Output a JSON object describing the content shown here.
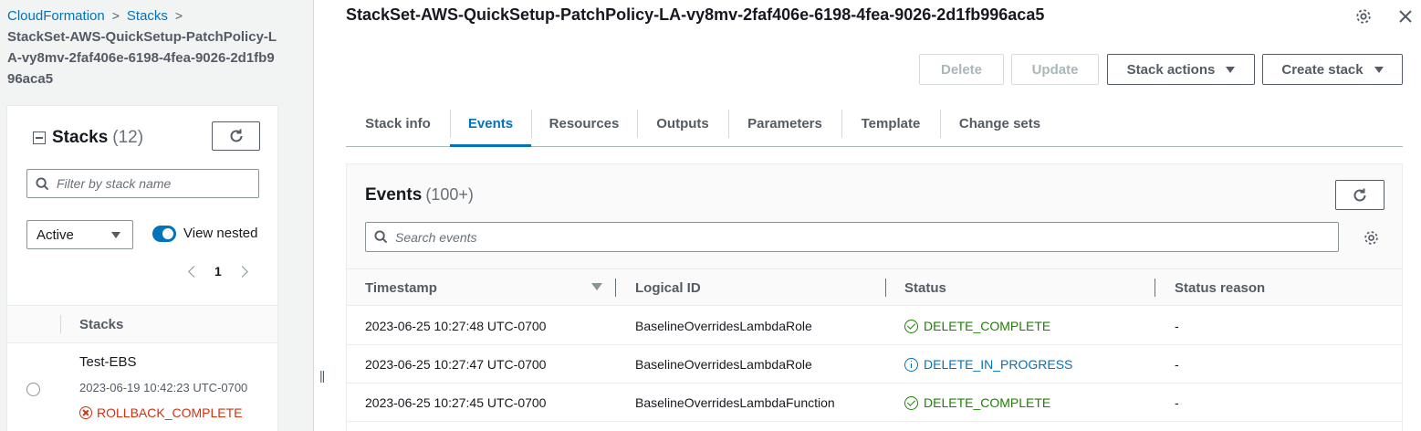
{
  "breadcrumb": {
    "items": [
      "CloudFormation",
      "Stacks"
    ],
    "current": "StackSet-AWS-QuickSetup-PatchPolicy-LA-vy8mv-2faf406e-6198-4fea-9026-2d1fb996aca5"
  },
  "stacks_panel": {
    "title": "Stacks",
    "count": "(12)",
    "filter_placeholder": "Filter by stack name",
    "status_filter": "Active",
    "view_nested_label": "View nested",
    "page": "1",
    "column_header": "Stacks",
    "stacks": [
      {
        "name": "Test-EBS",
        "date": "2023-06-19 10:42:23 UTC-0700",
        "status": "ROLLBACK_COMPLETE"
      }
    ]
  },
  "main": {
    "title": "StackSet-AWS-QuickSetup-PatchPolicy-LA-vy8mv-2faf406e-6198-4fea-9026-2d1fb996aca5",
    "buttons": {
      "delete": "Delete",
      "update": "Update",
      "stack_actions": "Stack actions",
      "create_stack": "Create stack"
    },
    "tabs": [
      "Stack info",
      "Events",
      "Resources",
      "Outputs",
      "Parameters",
      "Template",
      "Change sets"
    ],
    "active_tab": "Events"
  },
  "events": {
    "title": "Events",
    "count": "(100+)",
    "search_placeholder": "Search events",
    "columns": [
      "Timestamp",
      "Logical ID",
      "Status",
      "Status reason"
    ],
    "rows": [
      {
        "timestamp": "2023-06-25 10:27:48 UTC-0700",
        "logical_id": "BaselineOverridesLambdaRole",
        "status": "DELETE_COMPLETE",
        "reason": "-"
      },
      {
        "timestamp": "2023-06-25 10:27:47 UTC-0700",
        "logical_id": "BaselineOverridesLambdaRole",
        "status": "DELETE_IN_PROGRESS",
        "reason": "-"
      },
      {
        "timestamp": "2023-06-25 10:27:45 UTC-0700",
        "logical_id": "BaselineOverridesLambdaFunction",
        "status": "DELETE_COMPLETE",
        "reason": "-"
      }
    ]
  },
  "colors": {
    "link": "#0073bb",
    "success": "#1d8102",
    "error": "#d13212",
    "in_progress": "#0073bb"
  }
}
